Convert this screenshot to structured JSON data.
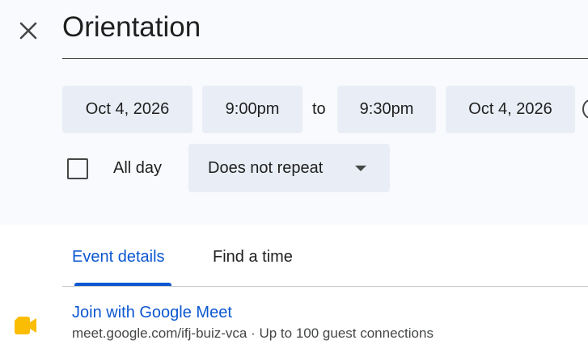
{
  "event": {
    "title": "Orientation"
  },
  "datetime": {
    "start_date": "Oct 4, 2026",
    "start_time": "9:00pm",
    "separator": "to",
    "end_time": "9:30pm",
    "end_date": "Oct 4, 2026"
  },
  "options": {
    "all_day_label": "All day",
    "all_day_checked": false,
    "repeat_value": "Does not repeat"
  },
  "tabs": [
    {
      "label": "Event details",
      "active": true
    },
    {
      "label": "Find a time",
      "active": false
    }
  ],
  "meet": {
    "link_label": "Join with Google Meet",
    "details": "meet.google.com/ifj-buiz-vca · Up to 100 guest connections"
  },
  "colors": {
    "accent": "#0b57d0",
    "chip_bg": "#e9eef6",
    "header_bg": "#f8fafd",
    "meet_yellow": "#fbbc04"
  },
  "icons": {
    "close": "close-icon",
    "dropdown": "caret-down-icon",
    "meet": "google-meet-icon"
  }
}
